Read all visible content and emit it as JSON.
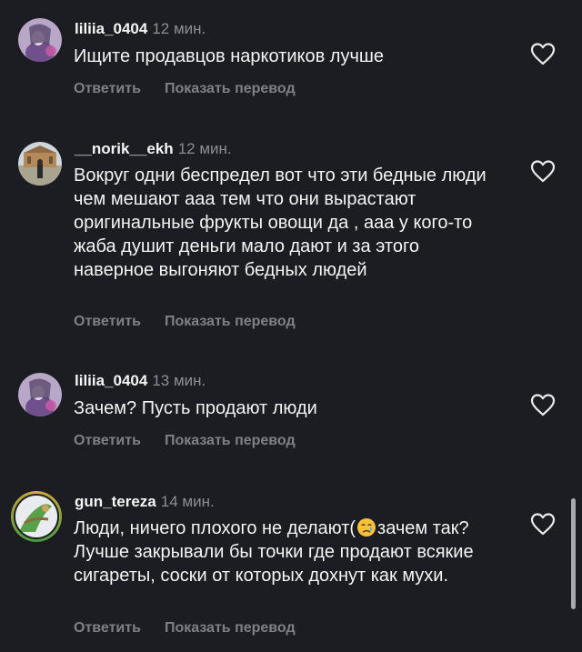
{
  "comments": [
    {
      "username": "liliia_0404",
      "time": "12 мин.",
      "text": "Ищите продавцов наркотиков лучше",
      "reply_label": "Ответить",
      "translate_label": "Показать перевод"
    },
    {
      "username": "__norik__ekh",
      "time": "12 мин.",
      "text": "Вокруг одни беспредел вот что эти бедные люди чем мешают ааа тем что они вырастают оригинальные фрукты овощи да , ааа у кого-то жаба душит деньги мало дают и за этого наверное выгоняют бедных людей",
      "reply_label": "Ответить",
      "translate_label": "Показать перевод"
    },
    {
      "username": "liliia_0404",
      "time": "13 мин.",
      "text": "Зачем? Пусть продают люди",
      "reply_label": "Ответить",
      "translate_label": "Показать перевод"
    },
    {
      "username": "gun_tereza",
      "time": "14 мин.",
      "text_before_emoji": "Люди, ничего плохого не делают(",
      "emoji": "crying-face",
      "text_after_emoji": "зачем так? Лучше закрывали бы точки где продают всякие сигареты, соски от которых дохнут как мухи.",
      "reply_label": "Ответить",
      "translate_label": "Показать перевод"
    }
  ],
  "icons": {
    "like": "heart-outline-icon"
  },
  "colors": {
    "background": "#1b1d22",
    "text": "#f4f4f4",
    "muted": "#8e8e93",
    "actions": "#7f8085"
  }
}
